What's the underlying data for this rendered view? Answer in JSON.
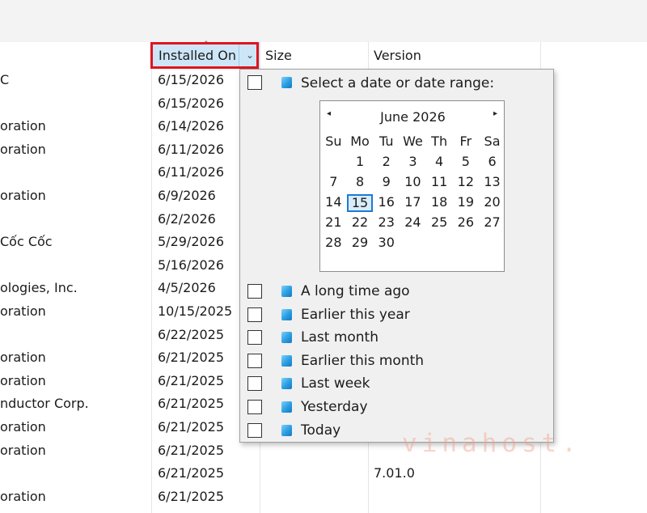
{
  "columns": {
    "installed_on": "Installed On",
    "size": "Size",
    "version": "Version",
    "dropdown_glyph": "⌄",
    "sort_glyph": "^"
  },
  "rows": [
    {
      "publisher": "C",
      "date": "6/15/2026",
      "version": ""
    },
    {
      "publisher": "",
      "date": "6/15/2026",
      "version": ""
    },
    {
      "publisher": "oration",
      "date": "6/14/2026",
      "version": ""
    },
    {
      "publisher": "oration",
      "date": "6/11/2026",
      "version": ""
    },
    {
      "publisher": "",
      "date": "6/11/2026",
      "version": ""
    },
    {
      "publisher": "oration",
      "date": "6/9/2026",
      "version": ""
    },
    {
      "publisher": "",
      "date": "6/2/2026",
      "version": ""
    },
    {
      "publisher": "Cốc Cốc",
      "date": "5/29/2026",
      "version": ""
    },
    {
      "publisher": "",
      "date": "5/16/2026",
      "version": ""
    },
    {
      "publisher": "ologies, Inc.",
      "date": "4/5/2026",
      "version": ""
    },
    {
      "publisher": "oration",
      "date": "10/15/2025",
      "version": ""
    },
    {
      "publisher": "",
      "date": "6/22/2025",
      "version": ""
    },
    {
      "publisher": "oration",
      "date": "6/21/2025",
      "version": ""
    },
    {
      "publisher": "oration",
      "date": "6/21/2025",
      "version": ""
    },
    {
      "publisher": "nductor Corp.",
      "date": "6/21/2025",
      "version": ""
    },
    {
      "publisher": "oration",
      "date": "6/21/2025",
      "version": ""
    },
    {
      "publisher": "oration",
      "date": "6/21/2025",
      "version": ""
    },
    {
      "publisher": "",
      "date": "6/21/2025",
      "version": "7.01.0"
    },
    {
      "publisher": "oration",
      "date": "6/21/2025",
      "version": ""
    }
  ],
  "filter": {
    "date_range_label": "Select a date or date range:",
    "calendar": {
      "title": "June 2026",
      "prev_glyph": "◂",
      "next_glyph": "▸",
      "weekdays": [
        "Su",
        "Mo",
        "Tu",
        "We",
        "Th",
        "Fr",
        "Sa"
      ],
      "weeks": [
        [
          "",
          "1",
          "2",
          "3",
          "4",
          "5",
          "6"
        ],
        [
          "7",
          "8",
          "9",
          "10",
          "11",
          "12",
          "13"
        ],
        [
          "14",
          "15",
          "16",
          "17",
          "18",
          "19",
          "20"
        ],
        [
          "21",
          "22",
          "23",
          "24",
          "25",
          "26",
          "27"
        ],
        [
          "28",
          "29",
          "30",
          "",
          "",
          "",
          ""
        ]
      ],
      "today": "15"
    },
    "options": [
      "A long time ago",
      "Earlier this year",
      "Last month",
      "Earlier this month",
      "Last week",
      "Yesterday",
      "Today"
    ]
  },
  "watermark": "vinahost.",
  "colors": {
    "header_highlight": "#cde6f7",
    "highlight_box": "#e0141e",
    "today_border": "#1c7ad8"
  }
}
